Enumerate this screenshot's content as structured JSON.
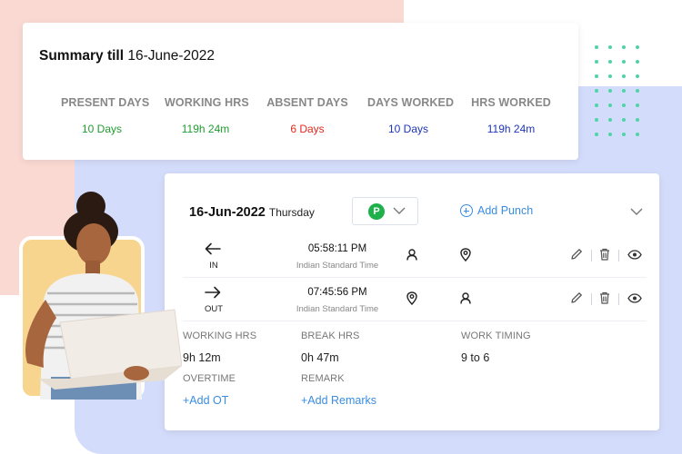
{
  "summary": {
    "title_prefix": "Summary till",
    "date": "16-June-2022",
    "stats": [
      {
        "label": "PRESENT DAYS",
        "value": "10 Days",
        "color": "#1f9d2f"
      },
      {
        "label": "WORKING HRS",
        "value": "119h 24m",
        "color": "#1f9d2f"
      },
      {
        "label": "ABSENT DAYS",
        "value": "6 Days",
        "color": "#e0291f"
      },
      {
        "label": "DAYS WORKED",
        "value": "10 Days",
        "color": "#1d36b8"
      },
      {
        "label": "HRS WORKED",
        "value": "119h 24m",
        "color": "#1d36b8"
      }
    ]
  },
  "detail": {
    "date": "16-Jun-2022",
    "weekday": "Thursday",
    "status_badge": "P",
    "add_punch_label": "Add Punch",
    "punches": [
      {
        "direction": "IN",
        "time": "05:58:11 PM",
        "timezone": "Indian Standard Time"
      },
      {
        "direction": "OUT",
        "time": "07:45:56 PM",
        "timezone": "Indian Standard Time"
      }
    ],
    "working_hrs_label": "WORKING HRS",
    "working_hrs_value": "9h 12m",
    "break_hrs_label": "BREAK HRS",
    "break_hrs_value": "0h 47m",
    "work_timing_label": "WORK TIMING",
    "work_timing_value": "9 to 6",
    "overtime_label": "OVERTIME",
    "add_ot_label": "+Add OT",
    "remark_label": "REMARK",
    "add_remarks_label": "+Add Remarks"
  },
  "icons": {
    "in_arrow": "arrow-left-icon",
    "out_arrow": "arrow-right-icon",
    "user": "user-icon",
    "location": "location-pin-icon",
    "edit": "pencil-icon",
    "delete": "trash-icon",
    "view": "eye-icon",
    "dropdown": "chevron-down-icon"
  },
  "colors": {
    "accent": "#3a8de0",
    "present_green": "#1db04b",
    "bg_pink": "#fbd9d3",
    "bg_blue": "#d3dcfb",
    "dots": "#4fd3a5"
  }
}
